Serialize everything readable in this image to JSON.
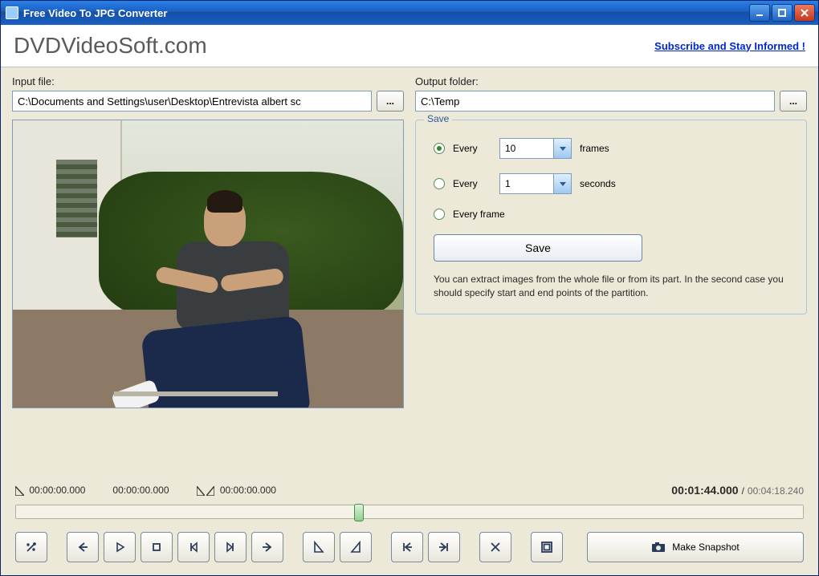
{
  "window": {
    "title": "Free Video To JPG Converter"
  },
  "header": {
    "brand": "DVDVideoSoft.com",
    "subscribe": "Subscribe and Stay Informed !"
  },
  "io": {
    "input_label": "Input file:",
    "input_value": "C:\\Documents and Settings\\user\\Desktop\\Entrevista albert sc",
    "output_label": "Output folder:",
    "output_value": "C:\\Temp",
    "browse_label": "..."
  },
  "save": {
    "legend": "Save",
    "opt_every_label": "Every",
    "frames_value": "10",
    "frames_unit": "frames",
    "seconds_value": "1",
    "seconds_unit": "seconds",
    "every_frame_label": "Every frame",
    "save_button": "Save",
    "help": "You can extract images from the whole file or from its part. In the second case you should specify start and end points of the partition."
  },
  "timeline": {
    "start_time": "00:00:00.000",
    "mid_time": "00:00:00.000",
    "end_time": "00:00:00.000",
    "current": "00:01:44.000",
    "sep": " / ",
    "total": "00:04:18.240"
  },
  "controls": {
    "snapshot": "Make Snapshot"
  }
}
